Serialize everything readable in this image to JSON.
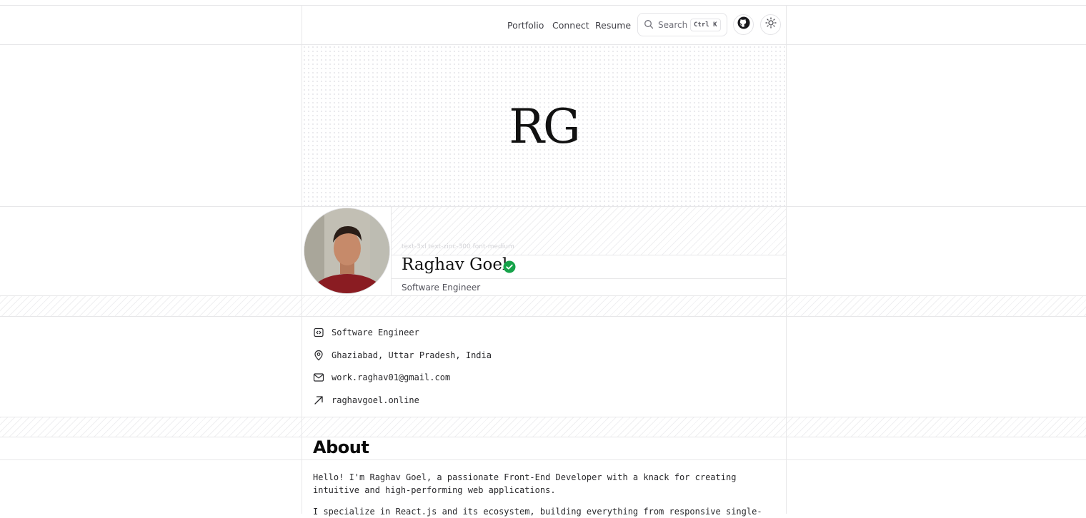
{
  "nav": {
    "links": [
      "Portfolio",
      "Connect",
      "Resume"
    ],
    "search_placeholder": "Search",
    "shortcut": "Ctrl K",
    "github_icon": "github-icon",
    "theme_icon": "sun-icon"
  },
  "hero": {
    "monogram": "RG"
  },
  "profile": {
    "class_note": "text-3xl text-zinc-300 font-medium",
    "name": "Raghav Goel",
    "verified_color": "#16a34a",
    "role": "Software Engineer"
  },
  "info": [
    {
      "icon": "code-icon",
      "text": "Software Engineer"
    },
    {
      "icon": "map-pin-icon",
      "text": "Ghaziabad, Uttar Pradesh, India"
    },
    {
      "icon": "mail-icon",
      "text": "work.raghav01@gmail.com"
    },
    {
      "icon": "arrow-up-right-icon",
      "text": "raghavgoel.online"
    }
  ],
  "about": {
    "heading": "About",
    "paragraphs": [
      "Hello! I'm Raghav Goel, a passionate Front-End Developer with a knack for creating intuitive and high-performing web applications.",
      "I specialize in React.js and its ecosystem, building everything from responsive single-"
    ]
  }
}
